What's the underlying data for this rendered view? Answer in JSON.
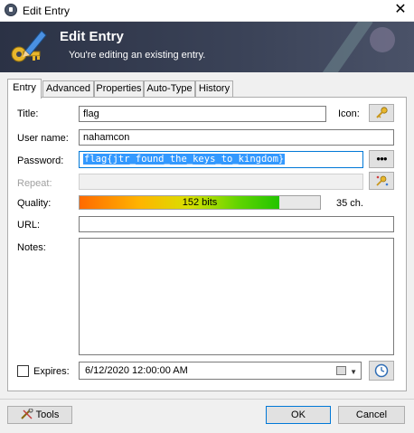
{
  "window": {
    "title": "Edit Entry",
    "close_glyph": "✕"
  },
  "banner": {
    "heading": "Edit Entry",
    "subtitle": "You're editing an existing entry."
  },
  "tabs": [
    {
      "label": "Entry",
      "active": true
    },
    {
      "label": "Advanced",
      "active": false
    },
    {
      "label": "Properties",
      "active": false
    },
    {
      "label": "Auto-Type",
      "active": false
    },
    {
      "label": "History",
      "active": false
    }
  ],
  "form": {
    "title_label": "Title:",
    "title_value": "flag",
    "icon_label": "Icon:",
    "username_label": "User name:",
    "username_value": "nahamcon",
    "password_label": "Password:",
    "password_value": "flag{jtr_found_the_keys_to_kingdom}",
    "password_toggle": "●●●",
    "repeat_label": "Repeat:",
    "repeat_value": "",
    "quality_label": "Quality:",
    "quality_text": "152 bits",
    "quality_fraction": 0.83,
    "quality_chars": "35 ch.",
    "url_label": "URL:",
    "url_value": "",
    "notes_label": "Notes:",
    "notes_value": "",
    "expires_label": "Expires:",
    "expires_checked": false,
    "expires_value": "6/12/2020 12:00:00 AM"
  },
  "footer": {
    "tools_label": "Tools",
    "ok_label": "OK",
    "cancel_label": "Cancel"
  },
  "colors": {
    "banner": "#2b3245",
    "selection": "#3399ff",
    "focus": "#0078d7"
  },
  "icons": [
    "app-lock-icon",
    "keys-pen-logo-icon",
    "key-icon",
    "generate-password-icon",
    "calendar-icon",
    "clock-icon",
    "tools-icon"
  ]
}
